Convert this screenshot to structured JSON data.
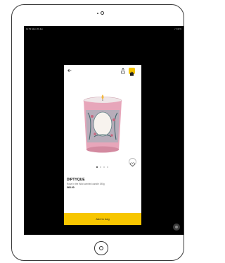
{
  "status_bar": {
    "time_date": "11:51 Mon 20 Jun",
    "indicators": "• ▾ 41%"
  },
  "product": {
    "brand": "DIPTYQUE",
    "description": "Rose In the Wild scented candle 190g",
    "price": "€63.00",
    "add_label": "Add to bag"
  },
  "carousel": {
    "count": 4,
    "active": 1
  },
  "colors": {
    "accent": "#f7c600",
    "screen_bg": "#000000"
  }
}
